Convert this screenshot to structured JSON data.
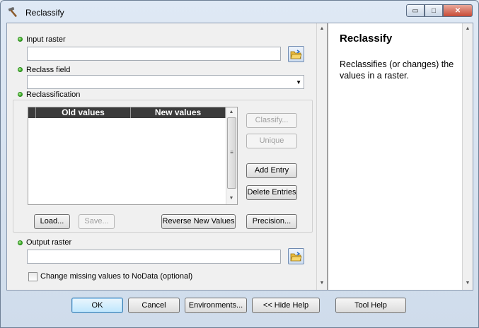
{
  "window": {
    "title": "Reclassify",
    "icon": "hammer-icon",
    "minimize_glyph": "▭",
    "maximize_glyph": "□",
    "close_glyph": "✕"
  },
  "form": {
    "input_raster": {
      "label": "Input raster",
      "value": ""
    },
    "reclass_field": {
      "label": "Reclass field",
      "value": ""
    },
    "reclassification": {
      "label": "Reclassification",
      "columns": [
        "Old values",
        "New values"
      ],
      "rows": [],
      "side_buttons": {
        "classify": "Classify...",
        "unique": "Unique",
        "add_entry": "Add Entry",
        "delete_entries": "Delete Entries"
      },
      "bottom_buttons": {
        "load": "Load...",
        "save": "Save...",
        "reverse": "Reverse New Values",
        "precision": "Precision..."
      }
    },
    "output_raster": {
      "label": "Output raster",
      "value": ""
    },
    "missing_values": {
      "label": "Change missing values to NoData (optional)",
      "checked": false
    }
  },
  "help": {
    "title": "Reclassify",
    "body": "Reclassifies (or changes) the values in a raster."
  },
  "footer": {
    "ok": "OK",
    "cancel": "Cancel",
    "environments": "Environments...",
    "hide_help": "<< Hide Help",
    "tool_help": "Tool Help"
  },
  "colors": {
    "required_dot": "#2ea31c",
    "table_header": "#3b3b3b",
    "window_frame": "#cfdceb"
  }
}
